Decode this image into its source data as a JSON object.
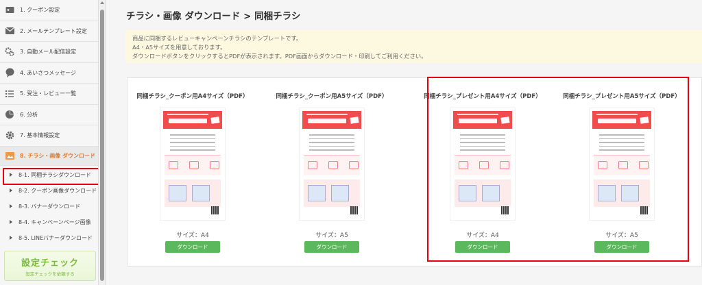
{
  "sidebar": {
    "items": [
      {
        "label": "1. クーポン設定",
        "icon": "coupon-icon"
      },
      {
        "label": "2. メールテンプレート設定",
        "icon": "mail-icon"
      },
      {
        "label": "3. 自動メール配信設定",
        "icon": "gears-icon"
      },
      {
        "label": "4. あいさつメッセージ",
        "icon": "speech-icon"
      },
      {
        "label": "5. 受注・レビュー一覧",
        "icon": "list-icon"
      },
      {
        "label": "6. 分析",
        "icon": "pie-chart-icon"
      },
      {
        "label": "7. 基本情報設定",
        "icon": "gear-icon"
      },
      {
        "label": "8. チラシ・画像 ダウンロード",
        "icon": "image-download-icon"
      }
    ],
    "sub_items": [
      {
        "label": "8-1. 同梱チラシダウンロード"
      },
      {
        "label": "8-2. クーポン画像ダウンロード"
      },
      {
        "label": "8-3. バナーダウンロード"
      },
      {
        "label": "8-4. キャンペーンページ画像"
      },
      {
        "label": "8-5. LINEバナーダウンロード"
      }
    ],
    "check": {
      "title": "設定チェック",
      "sub": "設定チェックを依頼する"
    }
  },
  "main": {
    "title": "チラシ・画像 ダウンロード > 同梱チラシ",
    "notice": [
      "商品に同梱するレビューキャンペーンチラシのテンプレートです。",
      "A4・A5サイズを用意しております。",
      "ダウンロードボタンをクリックするとPDFが表示されます。PDF画面からダウンロード・印刷してご利用ください。"
    ],
    "cards": [
      {
        "title": "同梱チラシ_クーポン用A4サイズ（PDF）",
        "size": "サイズ：A4",
        "button": "ダウンロード"
      },
      {
        "title": "同梱チラシ_クーポン用A5サイズ（PDF）",
        "size": "サイズ：A5",
        "button": "ダウンロード"
      },
      {
        "title": "同梱チラシ_プレゼント用A4サイズ（PDF）",
        "size": "サイズ：A4",
        "button": "ダウンロード"
      },
      {
        "title": "同梱チラシ_プレゼント用A5サイズ（PDF）",
        "size": "サイズ：A5",
        "button": "ダウンロード"
      }
    ]
  },
  "colors": {
    "accent": "#e07a2e",
    "button": "#5cb85c",
    "highlight": "#e60012",
    "flyer_red": "#f14b4b"
  }
}
